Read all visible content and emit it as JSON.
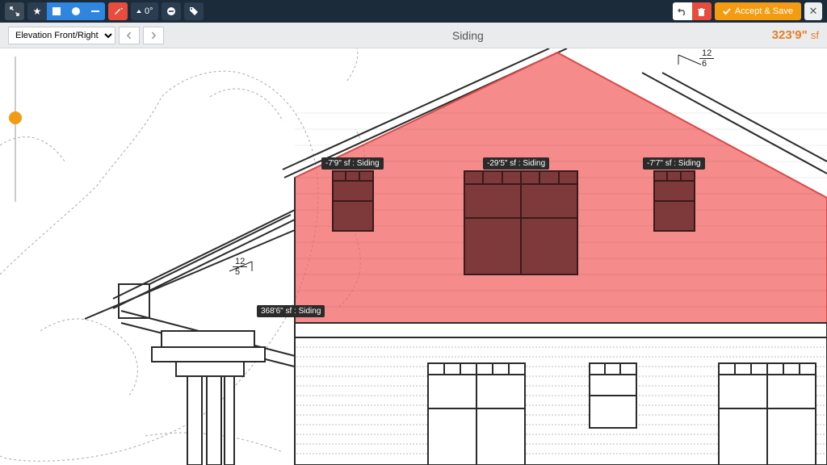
{
  "toolbar": {
    "angle_label": "0°",
    "accept_label": "Accept & Save"
  },
  "subbar": {
    "view_selected": "Elevation Front/Right",
    "title": "Siding",
    "measurement_value": "323'9\"",
    "measurement_unit": "sf"
  },
  "annotations": {
    "a1": "-7'9\" sf : Siding",
    "a2": "-29'5\" sf : Siding",
    "a3": "-7'7\" sf : Siding",
    "a4": "368'6\" sf : Siding"
  },
  "pitch_left": {
    "top": "12",
    "bot": "5"
  },
  "pitch_right": {
    "top": "12",
    "bot": "6"
  }
}
